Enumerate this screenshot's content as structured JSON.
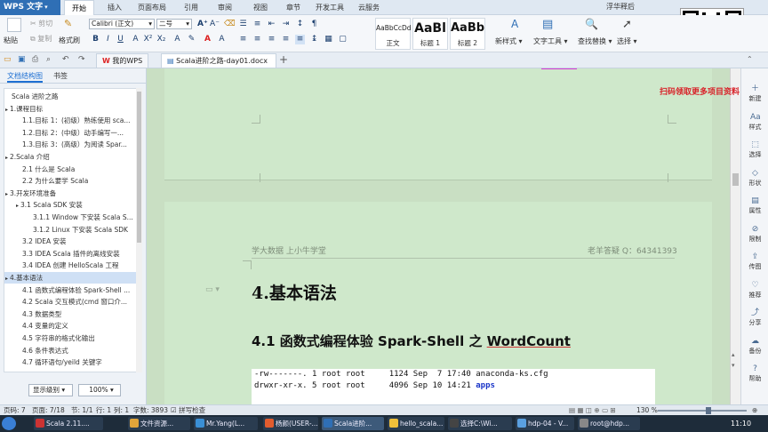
{
  "app": {
    "name": "WPS 文字",
    "user": "浮华释后"
  },
  "menu": [
    "开始",
    "插入",
    "页面布局",
    "引用",
    "审阅",
    "视图",
    "章节",
    "开发工具",
    "云服务"
  ],
  "ribbon": {
    "paste": "粘贴",
    "cut": "剪切",
    "copy": "复制",
    "format_painter": "格式刷",
    "font": "Calibri (正文)",
    "size": "二号",
    "styles": [
      {
        "sample": "AaBbCcDd",
        "name": "正文"
      },
      {
        "sample": "AaBl",
        "name": "标题 1"
      },
      {
        "sample": "AaBb",
        "name": "标题 2"
      }
    ],
    "new_style": "新样式",
    "text_tools": "文字工具",
    "find_replace": "查找替换",
    "select": "选择"
  },
  "tabs": [
    {
      "label": "我的WPS"
    },
    {
      "label": "Scala进阶之路-day01.docx"
    }
  ],
  "nav": {
    "tabs": [
      "文档结构图",
      "书签"
    ],
    "items": [
      {
        "text": "Scala 进阶之路",
        "level": 0
      },
      {
        "text": "1.课程目标",
        "level": 0,
        "toggle": "▸"
      },
      {
        "text": "1.1.目标 1：(初级）熟练使用 sca...",
        "level": 1
      },
      {
        "text": "1.2.目标 2：(中级）动手编写一...",
        "level": 1
      },
      {
        "text": "1.3.目标 3：(高级）为阅读 Spar...",
        "level": 1
      },
      {
        "text": "2.Scala 介绍",
        "level": 0,
        "toggle": "▸"
      },
      {
        "text": "2.1 什么是 Scala",
        "level": 1
      },
      {
        "text": "2.2 为什么要学 Scala",
        "level": 1
      },
      {
        "text": "3.开发环境准备",
        "level": 0,
        "toggle": "▸"
      },
      {
        "text": "3.1 Scala SDK 安装",
        "level": 1,
        "toggle": "▸"
      },
      {
        "text": "3.1.1 Window 下安装 Scala S...",
        "level": 2
      },
      {
        "text": "3.1.2 Linux 下安装 Scala SDK",
        "level": 2
      },
      {
        "text": "3.2 IDEA 安装",
        "level": 1
      },
      {
        "text": "3.3 IDEA Scala 插件的离线安装",
        "level": 1
      },
      {
        "text": "3.4 IDEA 创建 HelloScala 工程",
        "level": 1
      },
      {
        "text": "4.基本语法",
        "level": 0,
        "toggle": "▸",
        "selected": true
      },
      {
        "text": "4.1 函数式编程体验 Spark-Shell ...",
        "level": 1
      },
      {
        "text": "4.2 Scala 交互模式(cmd 窗口介...",
        "level": 1
      },
      {
        "text": "4.3 数据类型",
        "level": 1
      },
      {
        "text": "4.4 变量的定义",
        "level": 1
      },
      {
        "text": "4.5 字符串的格式化输出",
        "level": 1
      },
      {
        "text": "4.6 条件表达式",
        "level": 1
      },
      {
        "text": "4.7 循环语句/yeild 关键字",
        "level": 1
      }
    ],
    "display_level": "显示级别",
    "zoom": "100%"
  },
  "document": {
    "header_left": "学大数据 上小牛学堂",
    "header_right": "老羊答疑 Q：64341393",
    "h1": "4.基本语法",
    "h2_prefix": "4.1 函数式编程体验 Spark-Shell 之 ",
    "h2_link": "WordCount",
    "code": [
      {
        "text": "-rw-------. 1 root root     1124 Sep  7 17:40 anaconda-ks.cfg",
        "dir": ""
      },
      {
        "text": "drwxr-xr-x. 5 root root     4096 Sep 10 14:21 ",
        "dir": "apps"
      }
    ]
  },
  "promo": "扫码领取更多项目资料",
  "right_panel": [
    "新建",
    "样式",
    "选择",
    "形状",
    "属性",
    "限制",
    "传图",
    "推荐",
    "分享",
    "备份",
    "帮助"
  ],
  "status": {
    "page": "页码: 7",
    "pages": "页面: 7/18",
    "section": "节: 1/1",
    "row": "行: 1",
    "col": "列: 1",
    "words": "字数: 3893",
    "spell": "拼写检查",
    "zoom": "130 %"
  },
  "taskbar": [
    {
      "label": "Scala 2.11....",
      "color": "#c33"
    },
    {
      "label": "文件资源...",
      "color": "#e0a43a"
    },
    {
      "label": "Mr.Yang(L...",
      "color": "#3a8fd5"
    },
    {
      "label": "杨颜(USER-...",
      "color": "#e25c2e"
    },
    {
      "label": "Scala进阶...",
      "color": "#2f6fb5"
    },
    {
      "label": "hello_scala...",
      "color": "#f0c03a"
    },
    {
      "label": "选择C:\\Wi...",
      "color": "#444"
    },
    {
      "label": "hdp-04 - V...",
      "color": "#5aa0e0"
    },
    {
      "label": "root@hdp...",
      "color": "#888"
    }
  ],
  "clock": "11:10",
  "accent": "#2f6fb5",
  "page_bg": "#cfe8cb"
}
